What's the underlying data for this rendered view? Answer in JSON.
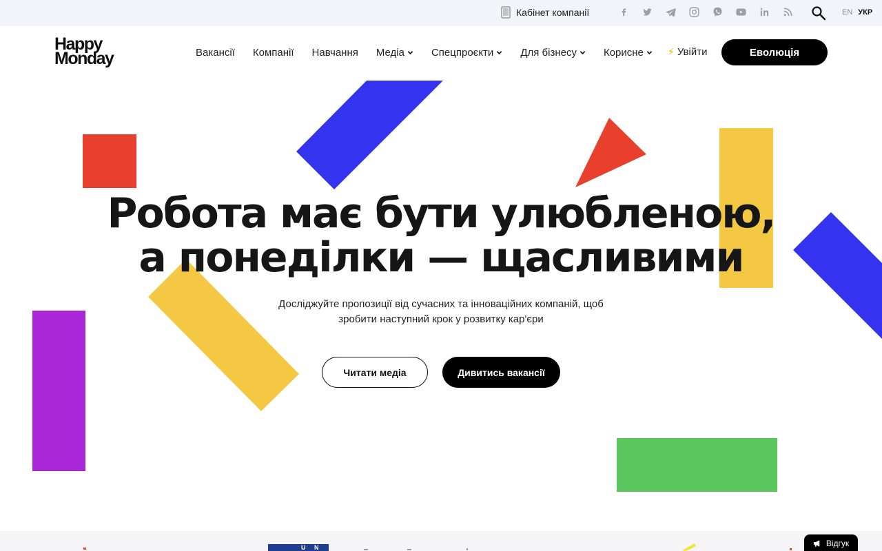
{
  "topbar": {
    "cabinet_label": "Кабінет компанії",
    "socials": [
      {
        "icon": "facebook-icon"
      },
      {
        "icon": "twitter-icon"
      },
      {
        "icon": "telegram-icon"
      },
      {
        "icon": "instagram-icon"
      },
      {
        "icon": "viber-icon"
      },
      {
        "icon": "youtube-icon"
      },
      {
        "icon": "linkedin-icon"
      },
      {
        "icon": "rss-icon"
      }
    ],
    "search_icon": "search-icon",
    "languages": {
      "en": "EN",
      "ukr": "УКР",
      "active": "УКР"
    }
  },
  "header": {
    "logo_line1": "Happy",
    "logo_line2": "Monday",
    "nav": {
      "vacancies": "Вакансії",
      "companies": "Компанії",
      "learning": "Навчання",
      "media": "Медіа",
      "special": "Спецпроєкти",
      "business": "Для бізнесу",
      "useful": "Корисне"
    },
    "login_label": "Увійти",
    "login_icon": "lightning-icon",
    "cta_label": "Еволюція"
  },
  "hero": {
    "title_line1": "Робота має бути улюбленою,",
    "title_line2": "а понеділки — щасливими",
    "subtitle_line1": "Досліджуйте пропозиції від сучасних та інноваційних компаній, щоб",
    "subtitle_line2": "зробити наступний крок у розвитку кар'єри",
    "btn_media": "Читати медіа",
    "btn_vacancies": "Дивитись вакансії"
  },
  "colors": {
    "red": "#e8402c",
    "blue": "#3333f0",
    "yellow": "#f5c843",
    "purple": "#a927d6",
    "green": "#5bc75e",
    "black": "#000000"
  },
  "partners": {
    "un_left": "U",
    "un_right": "N"
  },
  "feedback": {
    "label": "Відгук",
    "icon": "megaphone-icon"
  }
}
